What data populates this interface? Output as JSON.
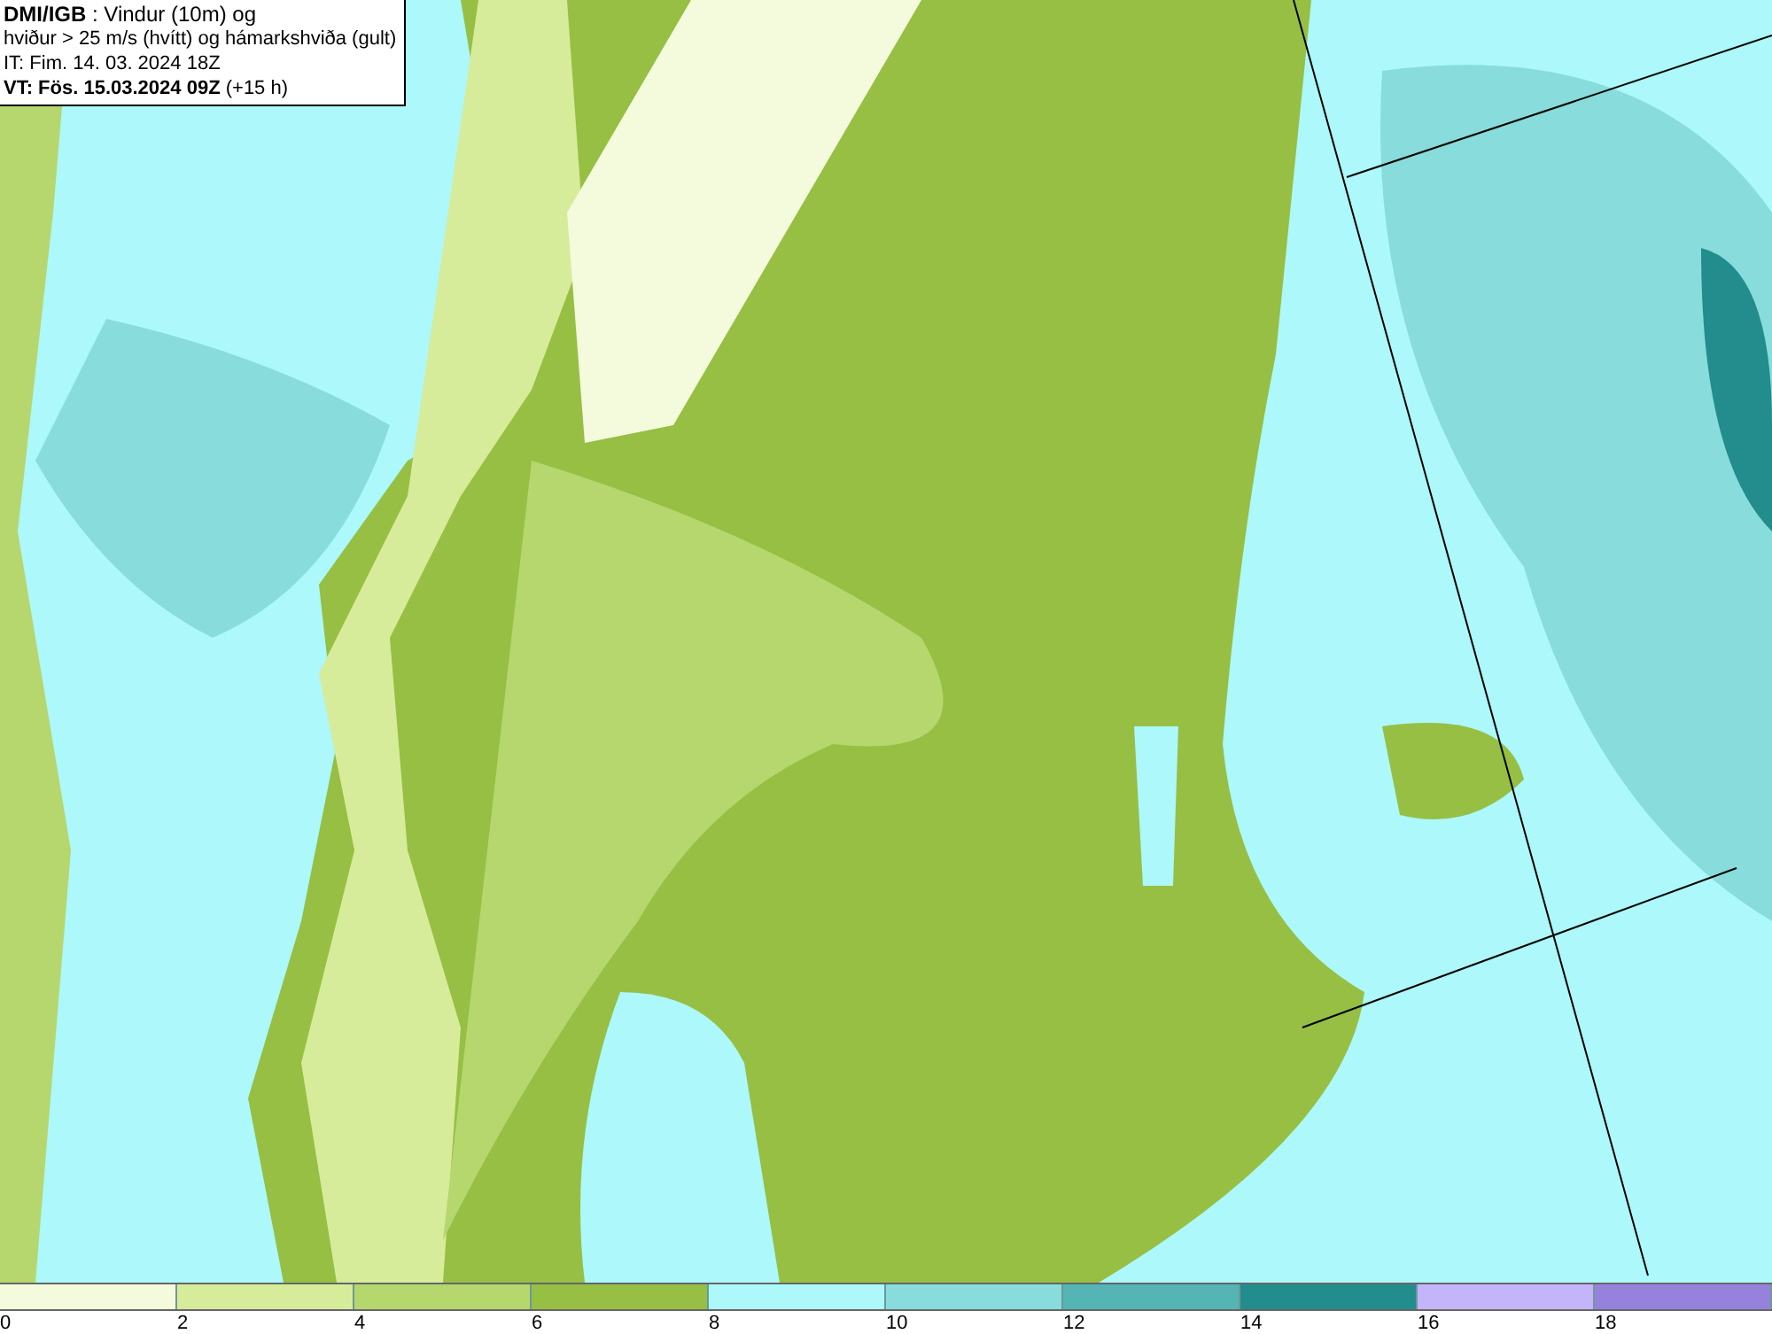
{
  "header": {
    "lines": [
      "**DMI/IGB** : Vindur (10m) og",
      "hviður > 25 m/s (hvítt) og hámarkshviða (gult)",
      "IT: Fim. 14. 03. 2024 18Z",
      "**VT: Fös. 15.03.2024 09Z** (+15 h)"
    ]
  },
  "legend": {
    "bins": [
      {
        "label": "0",
        "color": "#f4fadc"
      },
      {
        "label": "2",
        "color": "#d6ec9a"
      },
      {
        "label": "4",
        "color": "#b5d76e"
      },
      {
        "label": "6",
        "color": "#96bf44"
      },
      {
        "label": "8",
        "color": "#acf8fa"
      },
      {
        "label": "10",
        "color": "#88dcdc"
      },
      {
        "label": "12",
        "color": "#55b4b4"
      },
      {
        "label": "14",
        "color": "#238c8c"
      },
      {
        "label": "16",
        "color": "#c4b4fa"
      },
      {
        "label": "18",
        "color": "#9682dc"
      }
    ]
  }
}
